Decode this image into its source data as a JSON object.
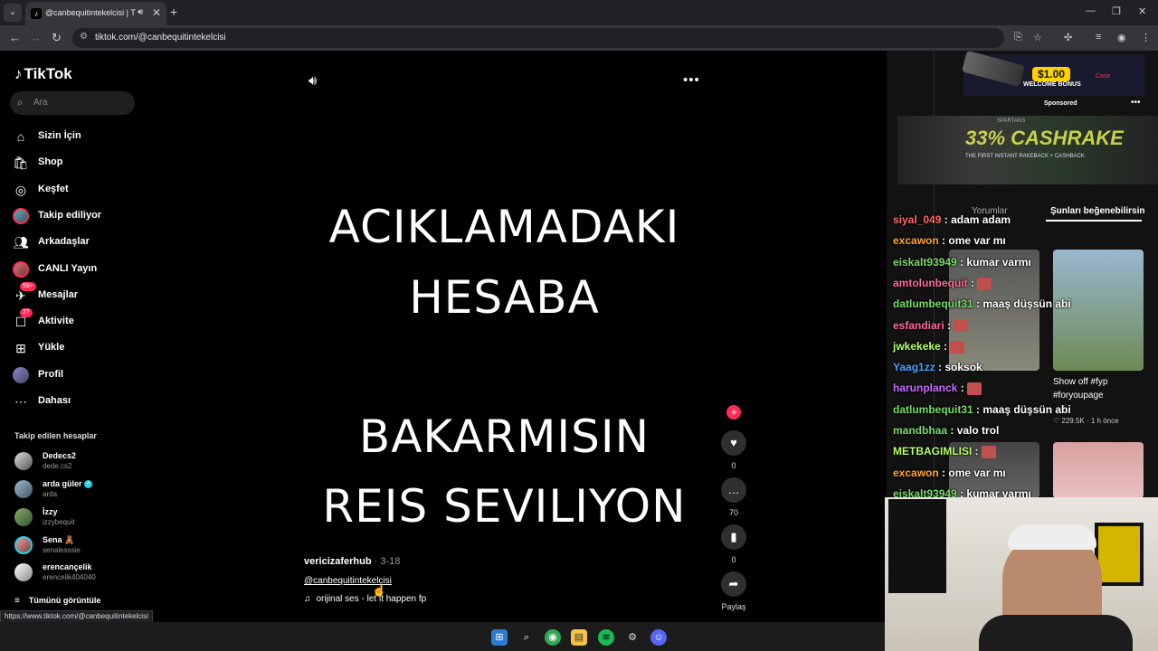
{
  "browser": {
    "tab_title": "@canbequitintekelcisi | TikTok",
    "tab_favicon": "tiktok-icon",
    "url": "tiktok.com/@canbequitintekelcisi",
    "status_url": "https://www.tiktok.com/@canbequitintekelcisi"
  },
  "sidebar": {
    "logo": "TikTok",
    "search_placeholder": "Ara",
    "nav": [
      {
        "label": "Sizin İçin",
        "icon": "home-icon"
      },
      {
        "label": "Shop",
        "icon": "shop-icon"
      },
      {
        "label": "Keşfet",
        "icon": "compass-icon"
      },
      {
        "label": "Takip ediliyor",
        "icon": "following-avatar-icon"
      },
      {
        "label": "Arkadaşlar",
        "icon": "friends-icon"
      },
      {
        "label": "CANLI Yayın",
        "icon": "live-avatar-icon"
      },
      {
        "label": "Mesajlar",
        "icon": "messages-icon",
        "badge": "99+"
      },
      {
        "label": "Aktivite",
        "icon": "activity-icon",
        "badge": "27"
      },
      {
        "label": "Yükle",
        "icon": "upload-icon"
      },
      {
        "label": "Profil",
        "icon": "profile-icon"
      },
      {
        "label": "Dahası",
        "icon": "more-icon"
      }
    ],
    "following_title": "Takip edilen hesaplar",
    "following": [
      {
        "name": "Dedecs2",
        "handle": "dede.cs2"
      },
      {
        "name": "arda güler",
        "handle": "arda",
        "verified": true
      },
      {
        "name": "İzzy",
        "handle": "izzybequit"
      },
      {
        "name": "Sena 🧸",
        "handle": "senalesssie"
      },
      {
        "name": "erencançelik",
        "handle": "erencelik404040"
      }
    ],
    "see_all": "Tümünü görüntüle"
  },
  "video": {
    "caption_lines": [
      "ACIKLAMADAKI",
      "HESABA",
      "BAKARMISIN",
      "REIS SEVILIYON"
    ],
    "author": "vericizaferhub",
    "date": "· 3-18",
    "mention": "@canbequitintekelcisi",
    "music": "orijinal ses - let it happen fp"
  },
  "actions": {
    "likes": "0",
    "comments": "70",
    "saves": "0",
    "share_label": "Paylaş"
  },
  "right_panel": {
    "ad_amount": "$1.00",
    "ad_bonus": "WELCOME BONUS",
    "ad_brand": "Case",
    "sponsored": "Sponsored",
    "banner_big": "33% CASHRAKE",
    "banner_small": "THE FIRST INSTANT RAKEBACK + CASHBACK",
    "banner_tag": "SPARTANS",
    "tab_comments": "Yorumlar",
    "tab_suggested": "Şunları beğenebilirsin",
    "thumb2_title": "Show off #fyp",
    "thumb2_tag": "#foryoupage",
    "thumb2_stats": "♡ 229.5K · 1 h önce"
  },
  "chat": [
    {
      "user": "siyal_049",
      "msg": "adam adam",
      "color": "#ff6b6b"
    },
    {
      "user": "excawon",
      "msg": "ome var mı",
      "color": "#ffa53a"
    },
    {
      "user": "eiskalt93949",
      "msg": "kumar varmı",
      "color": "#7bd96b"
    },
    {
      "user": "amtolunbequit",
      "msg": "",
      "color": "#ff6b9a",
      "emote": true
    },
    {
      "user": "datlumbequit31",
      "msg": "maaş düşsün abi",
      "color": "#7bd96b"
    },
    {
      "user": "esfandiari",
      "msg": "",
      "color": "#ff6b9a",
      "emote": true
    },
    {
      "user": "jwkekeke",
      "msg": "",
      "color": "#b6ff6b",
      "emote": true
    },
    {
      "user": "Yaag1zz",
      "msg": "soksok",
      "color": "#4aa3ff"
    },
    {
      "user": "harunplanck",
      "msg": "",
      "color": "#c66bff",
      "emote": true
    },
    {
      "user": "datlumbequit31",
      "msg": "maaş düşsün abi",
      "color": "#7bd96b"
    },
    {
      "user": "mandbhaa",
      "msg": "valo trol",
      "color": "#7bd96b"
    },
    {
      "user": "METBAGIMLISI",
      "msg": "",
      "color": "#b6ff6b",
      "emote": true
    },
    {
      "user": "excawon",
      "msg": "ome var mı",
      "color": "#ffa53a"
    },
    {
      "user": "eiskalt93949",
      "msg": "kumar varmı",
      "color": "#7bd96b"
    }
  ],
  "colors": {
    "accent": "#fe2c55",
    "background": "#000000"
  }
}
